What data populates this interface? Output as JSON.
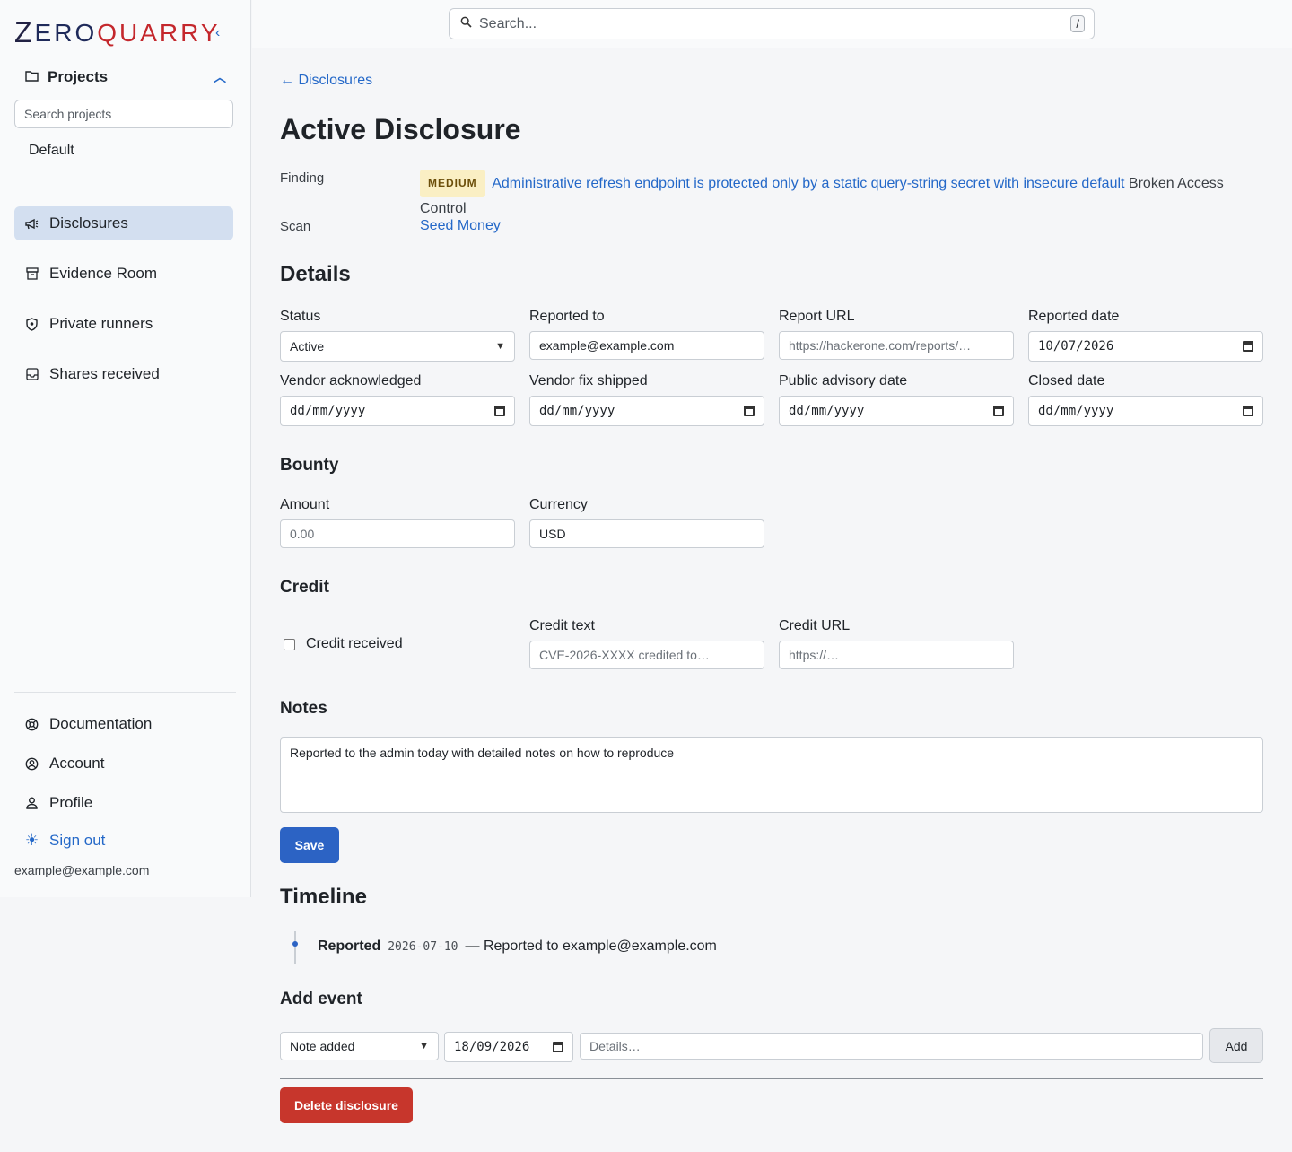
{
  "brand": {
    "z": "Z",
    "ero": "ERO",
    "quarry": "QUARRY"
  },
  "sidebar": {
    "collapse_icon": "chevron-left-icon",
    "projects": {
      "label": "Projects",
      "search_placeholder": "Search projects",
      "items": [
        "Default"
      ]
    },
    "nav": [
      {
        "label": "Disclosures",
        "icon": "megaphone-icon",
        "active": true
      },
      {
        "label": "Evidence Room",
        "icon": "archive-icon"
      },
      {
        "label": "Private runners",
        "icon": "shield-icon"
      },
      {
        "label": "Shares received",
        "icon": "inbox-icon"
      }
    ],
    "footer": [
      {
        "label": "Documentation",
        "icon": "lifebuoy-icon"
      },
      {
        "label": "Account",
        "icon": "user-circle-icon"
      },
      {
        "label": "Profile",
        "icon": "person-icon"
      },
      {
        "label": "Sign out",
        "icon": "sun-icon"
      }
    ],
    "email": "example@example.com"
  },
  "topbar": {
    "search_placeholder": "Search...",
    "shortcut": "/"
  },
  "page": {
    "back_label": "← Disclosures",
    "title": "Active Disclosure",
    "finding_label": "Finding",
    "severity": "MEDIUM",
    "finding_title": "Administrative refresh endpoint is protected only by a static query-string secret with insecure default",
    "finding_category": "Broken Access Control",
    "scan_label": "Scan",
    "scan_value": "Seed Money"
  },
  "details": {
    "heading": "Details",
    "status_label": "Status",
    "status_value": "Active",
    "reported_to_label": "Reported to",
    "reported_to_value": "example@example.com",
    "report_url_label": "Report URL",
    "report_url_placeholder": "https://hackerone.com/reports/…",
    "reported_date_label": "Reported date",
    "reported_date_value": "10/07/2026",
    "vendor_ack_label": "Vendor acknowledged",
    "vendor_ack_value": "dd/mm/yyyy",
    "vendor_fix_label": "Vendor fix shipped",
    "vendor_fix_value": "dd/mm/yyyy",
    "advisory_label": "Public advisory date",
    "advisory_value": "dd/mm/yyyy",
    "closed_label": "Closed date",
    "closed_value": "dd/mm/yyyy"
  },
  "bounty": {
    "heading": "Bounty",
    "amount_label": "Amount",
    "amount_placeholder": "0.00",
    "currency_label": "Currency",
    "currency_value": "USD"
  },
  "credit": {
    "heading": "Credit",
    "received_label": "Credit received",
    "text_label": "Credit text",
    "text_placeholder": "CVE-2026-XXXX credited to…",
    "url_label": "Credit URL",
    "url_placeholder": "https://…"
  },
  "notes": {
    "heading": "Notes",
    "value": "Reported to the admin today with detailed notes on how to reproduce",
    "save_label": "Save"
  },
  "timeline": {
    "heading": "Timeline",
    "events": [
      {
        "type": "Reported",
        "date": "2026-07-10",
        "text": "— Reported to example@example.com"
      }
    ]
  },
  "add_event": {
    "heading": "Add event",
    "type_value": "Note added",
    "date_value": "18/09/2026",
    "details_placeholder": "Details…",
    "add_label": "Add"
  },
  "delete_label": "Delete disclosure"
}
